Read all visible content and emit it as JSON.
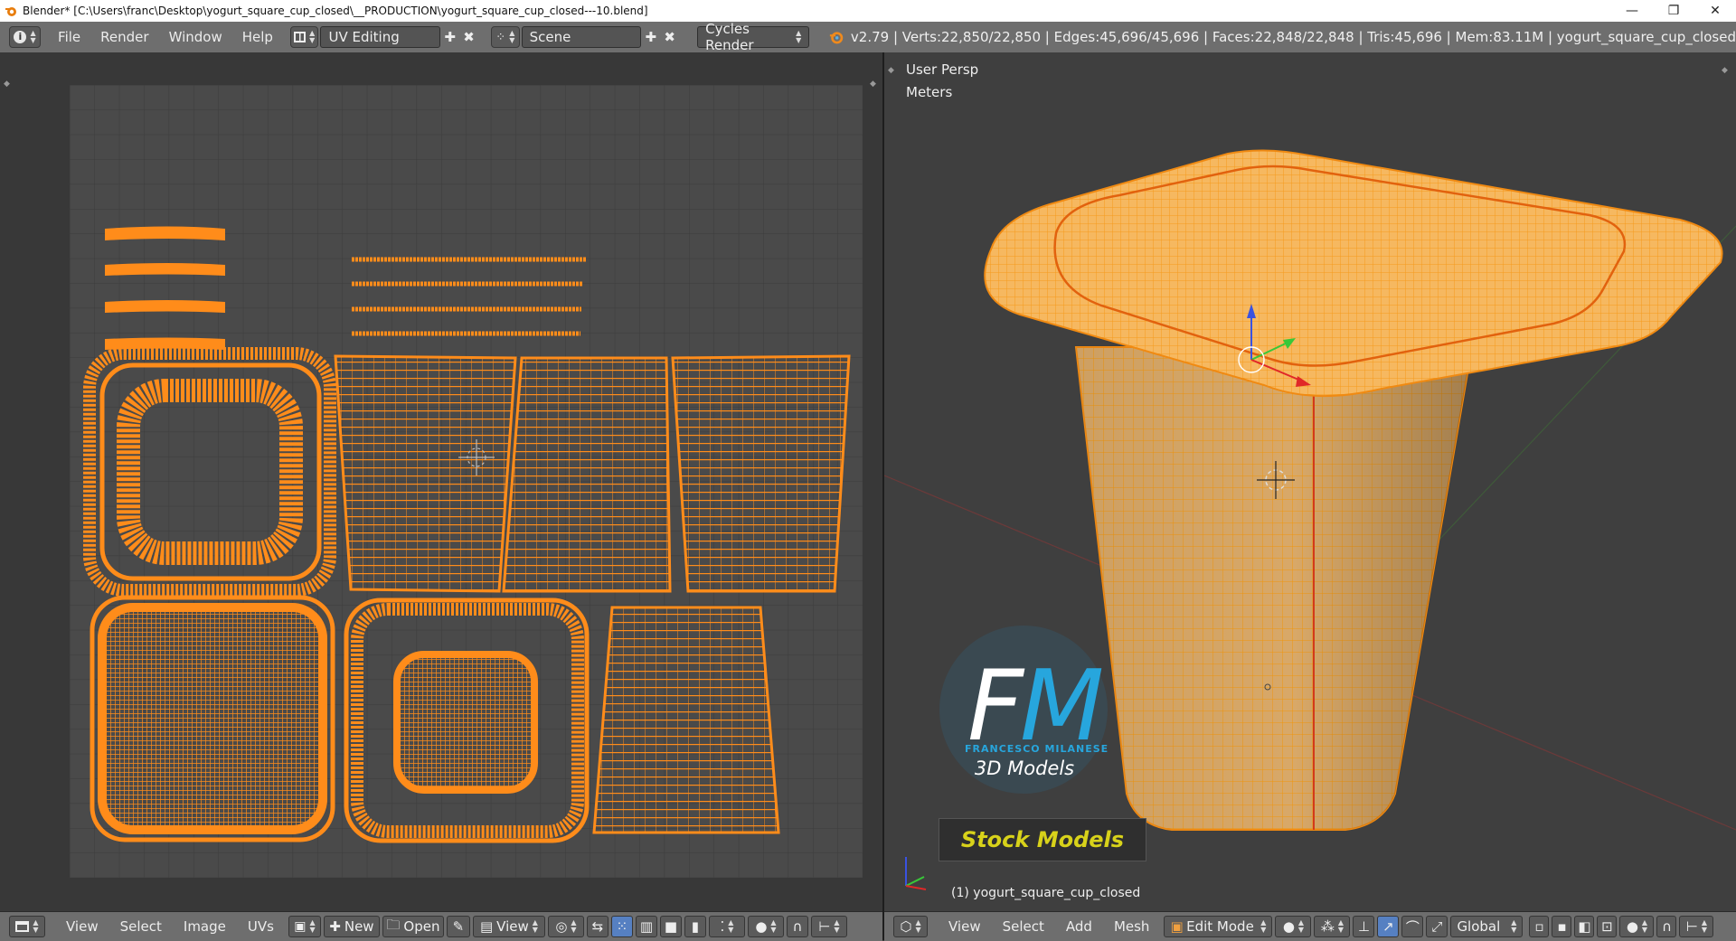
{
  "window": {
    "title": "Blender* [C:\\Users\\franc\\Desktop\\yogurt_square_cup_closed\\__PRODUCTION\\yogurt_square_cup_closed---10.blend]",
    "minimize": "—",
    "restore": "❐",
    "close": "✕"
  },
  "topbar": {
    "menus": [
      "File",
      "Render",
      "Window",
      "Help"
    ],
    "layout": "UV Editing",
    "scene": "Scene",
    "engine": "Cycles Render",
    "stats": "v2.79 | Verts:22,850/22,850 | Edges:45,696/45,696 | Faces:22,848/22,848 | Tris:45,696 | Mem:83.11M | yogurt_square_cup_closed"
  },
  "uv_editor": {
    "bottom_menus": [
      "View",
      "Select",
      "Image",
      "UVs"
    ],
    "new_label": "New",
    "open_label": "Open",
    "view_label": "View"
  },
  "viewport": {
    "view_name": "User Persp",
    "units": "Meters",
    "object_label": "(1) yogurt_square_cup_closed",
    "bottom_menus": [
      "View",
      "Select",
      "Add",
      "Mesh"
    ],
    "mode": "Edit Mode",
    "orientation": "Global"
  },
  "watermark": {
    "initials": "FM",
    "name": "FRANCESCO MILANESE",
    "subtitle": "3D Models",
    "banner": "Stock Models"
  },
  "colors": {
    "uv_orange": "#ff8c1a",
    "mesh_orange": "#f5a030",
    "banner_yellow": "#d8d21a",
    "fm_white": "#ffffff",
    "fm_blue": "#27a6dd"
  }
}
